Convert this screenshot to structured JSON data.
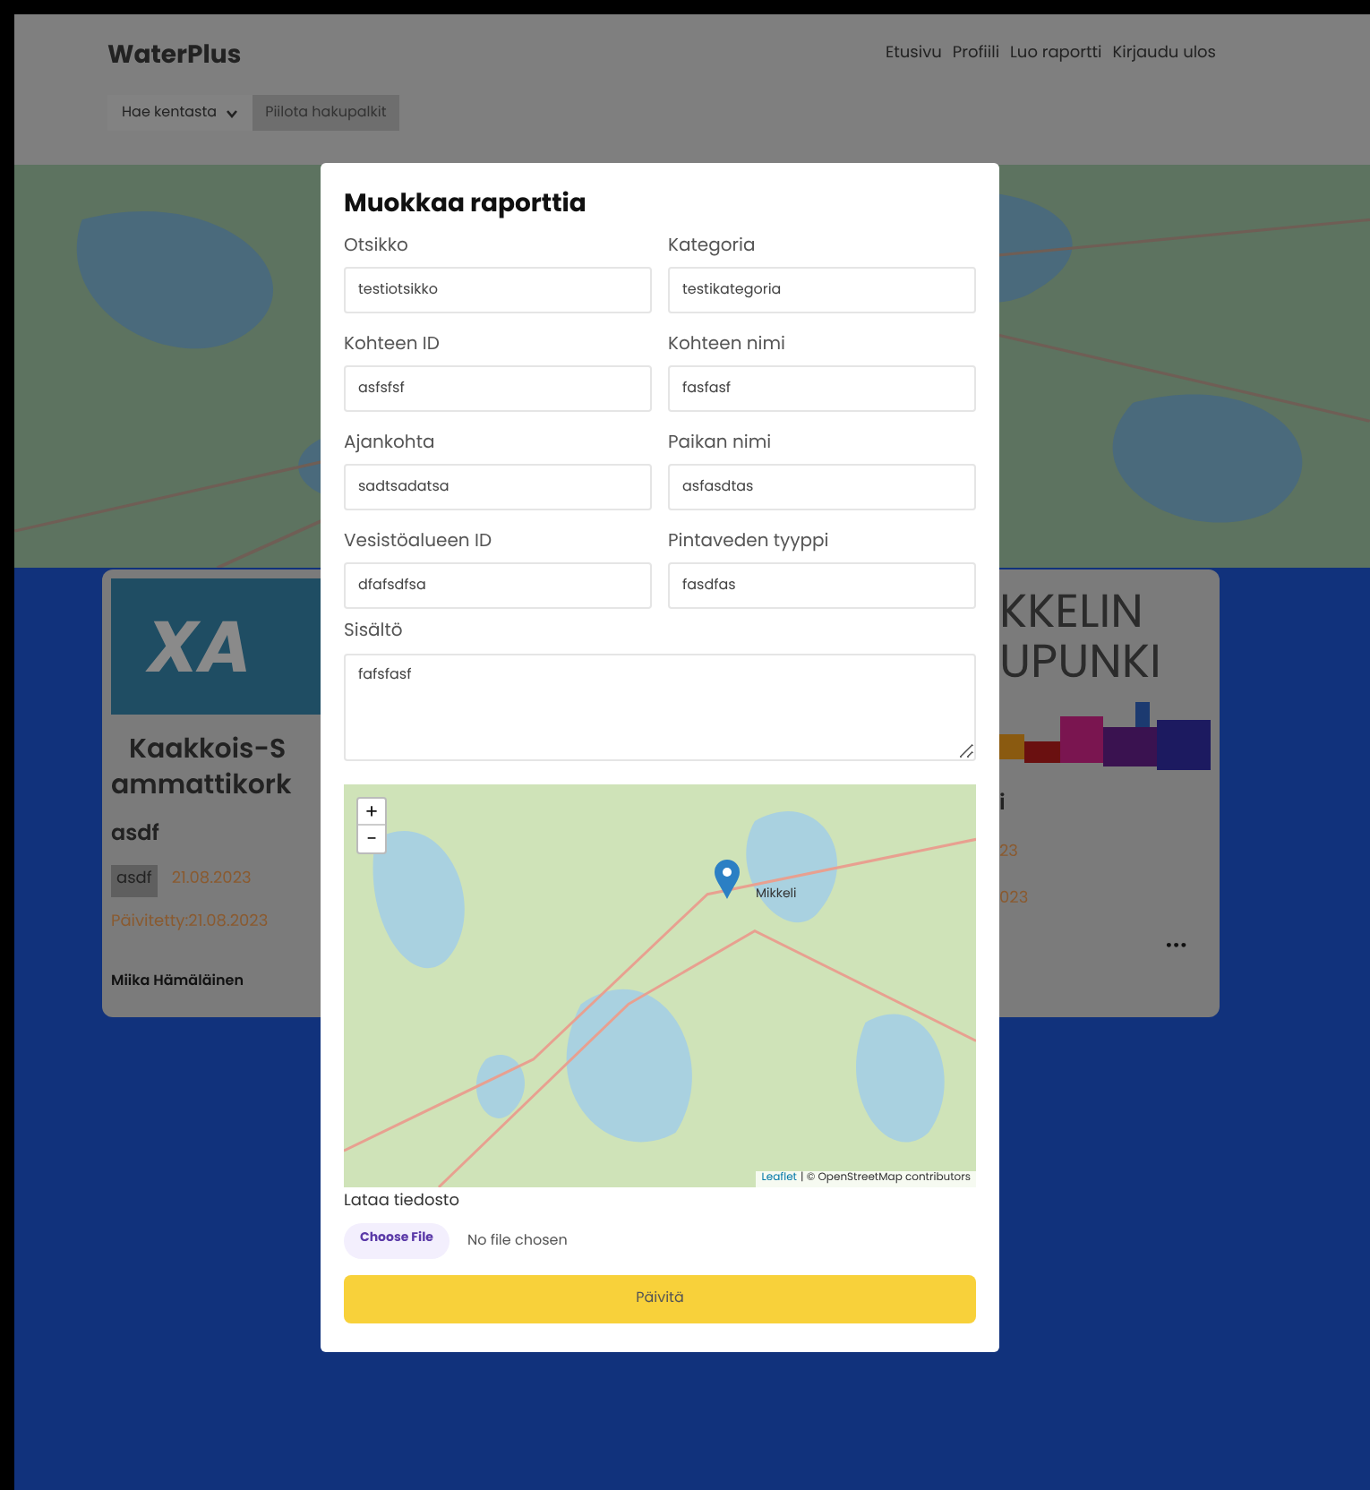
{
  "header": {
    "brand": "WaterPlus",
    "nav": [
      "Etusivu",
      "Profiili",
      "Luo raportti",
      "Kirjaudu ulos"
    ]
  },
  "search_bar": {
    "dropdown": "Hae kentasta",
    "toggle_button": "Piilota hakupalkit"
  },
  "cards": [
    {
      "kind": "left",
      "logo_text": "XA",
      "org_lines": [
        "Kaakkois-S",
        "ammattikork"
      ],
      "title": "asdf",
      "tag": "asdf",
      "date": "21.08.2023",
      "updated": "Päivitetty:21.08.2023",
      "author": "Miika Hämäläinen"
    },
    {
      "kind": "right",
      "logo_lines": [
        "KKELIN",
        "UPUNKI"
      ],
      "title": "i",
      "date": "23",
      "updated": "023",
      "menu": "•••"
    }
  ],
  "modal": {
    "title": "Muokkaa raporttia",
    "fields": [
      {
        "label": "Otsikko",
        "value": "testiotsikko"
      },
      {
        "label": "Kategoria",
        "value": "testikategoria"
      },
      {
        "label": "Kohteen ID",
        "value": "asfsfsf"
      },
      {
        "label": "Kohteen nimi",
        "value": "fasfasf"
      },
      {
        "label": "Ajankohta",
        "value": "sadtsadatsa"
      },
      {
        "label": "Paikan nimi",
        "value": "asfasdtas"
      },
      {
        "label": "Vesistöalueen ID",
        "value": "dfafsdfsa"
      },
      {
        "label": "Pintaveden tyyppi",
        "value": "fasdfas"
      }
    ],
    "content": {
      "label": "Sisältö",
      "value": "fafsfasf"
    },
    "map": {
      "zoom_in": "+",
      "zoom_out": "−",
      "place": "Mikkeli",
      "attribution_link": "Leaflet",
      "attribution_text": "| © OpenStreetMap contributors"
    },
    "file": {
      "label": "Lataa tiedosto",
      "button": "Choose File",
      "status": "No file chosen"
    },
    "submit": "Päivitä"
  }
}
